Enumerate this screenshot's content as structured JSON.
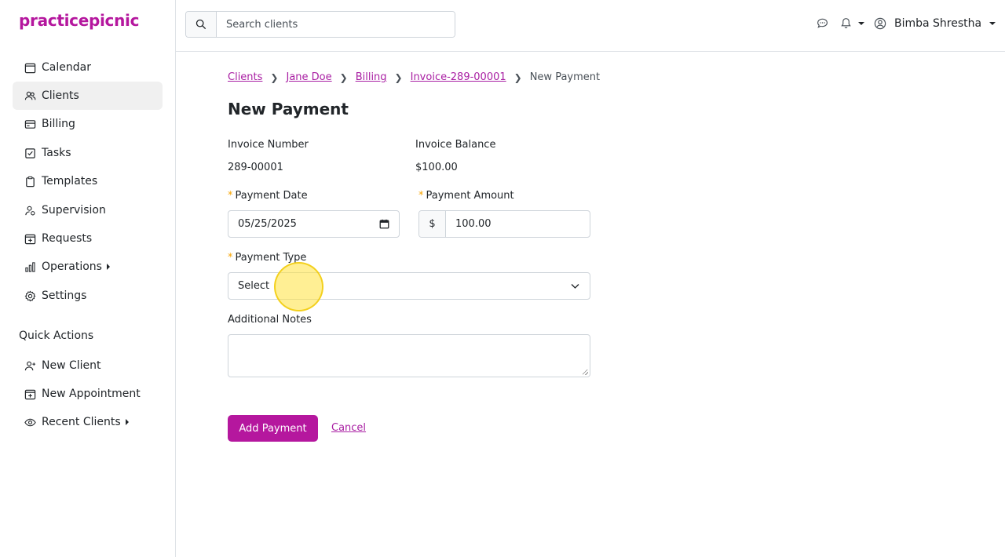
{
  "app": {
    "logo": "practicepicnic"
  },
  "sidebar": {
    "items": [
      {
        "label": "Calendar",
        "icon": "calendar-icon"
      },
      {
        "label": "Clients",
        "icon": "users-icon",
        "active": true
      },
      {
        "label": "Billing",
        "icon": "credit-card-icon"
      },
      {
        "label": "Tasks",
        "icon": "checkbox-icon"
      },
      {
        "label": "Templates",
        "icon": "clipboard-icon"
      },
      {
        "label": "Supervision",
        "icon": "supervisor-icon"
      },
      {
        "label": "Requests",
        "icon": "calendar-plus-icon"
      },
      {
        "label": "Operations",
        "icon": "bar-chart-icon",
        "expandable": true
      },
      {
        "label": "Settings",
        "icon": "gear-icon"
      }
    ],
    "quick_actions_label": "Quick Actions",
    "quick_actions": [
      {
        "label": "New Client",
        "icon": "user-plus-icon"
      },
      {
        "label": "New Appointment",
        "icon": "calendar-plus-icon"
      },
      {
        "label": "Recent Clients",
        "icon": "eye-icon",
        "expandable": true
      }
    ]
  },
  "topbar": {
    "search_placeholder": "Search clients",
    "user_name": "Bimba Shrestha"
  },
  "breadcrumb": {
    "links": [
      "Clients",
      "Jane Doe",
      "Billing",
      "Invoice-289-00001"
    ],
    "current": "New Payment"
  },
  "page": {
    "title": "New Payment"
  },
  "form": {
    "invoice_number_label": "Invoice Number",
    "invoice_number": "289-00001",
    "invoice_balance_label": "Invoice Balance",
    "invoice_balance": "$100.00",
    "payment_date_label": "Payment Date",
    "payment_date": "05/25/2025",
    "payment_amount_label": "Payment Amount",
    "currency_symbol": "$",
    "payment_amount": "100.00",
    "payment_type_label": "Payment Type",
    "payment_type_value": "Select",
    "notes_label": "Additional Notes",
    "notes_value": "",
    "submit_label": "Add Payment",
    "cancel_label": "Cancel"
  },
  "colors": {
    "brand": "#b5179e",
    "required": "#f7a400",
    "link": "#a91fa3"
  }
}
